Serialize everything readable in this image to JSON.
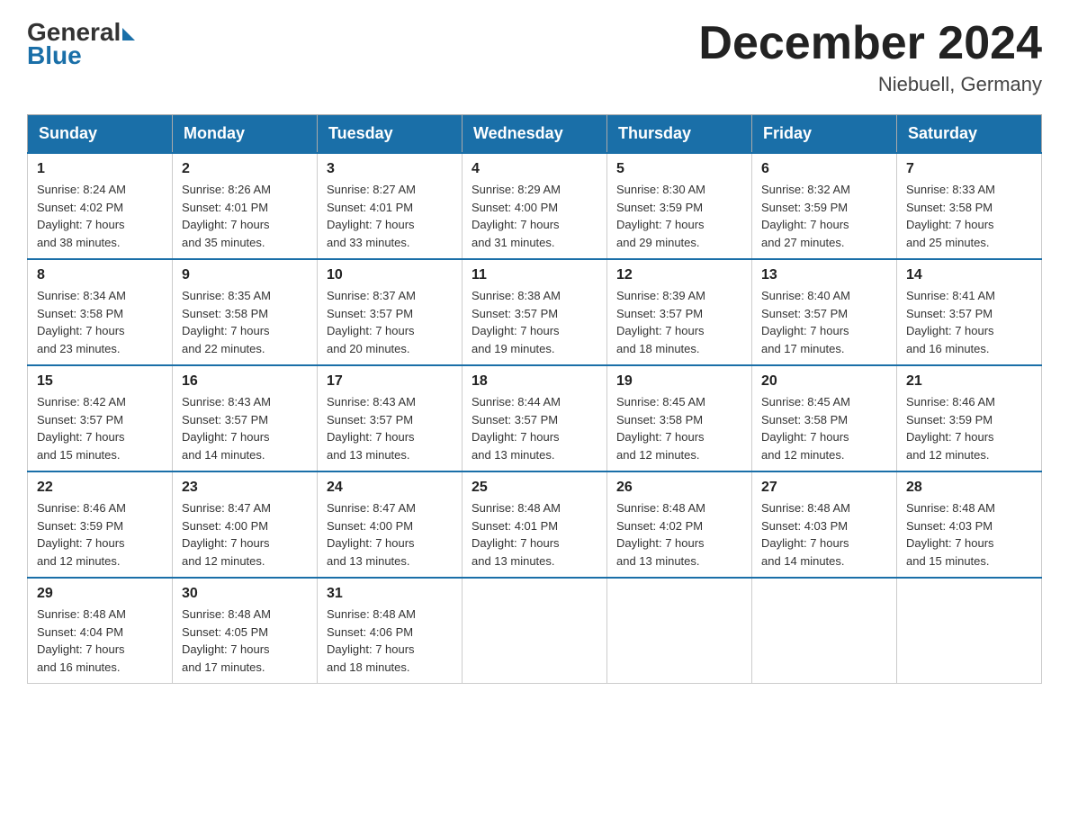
{
  "header": {
    "logo_general": "General",
    "logo_blue": "Blue",
    "month_title": "December 2024",
    "location": "Niebuell, Germany"
  },
  "days_of_week": [
    "Sunday",
    "Monday",
    "Tuesday",
    "Wednesday",
    "Thursday",
    "Friday",
    "Saturday"
  ],
  "weeks": [
    [
      {
        "day": "1",
        "sunrise": "Sunrise: 8:24 AM",
        "sunset": "Sunset: 4:02 PM",
        "daylight": "Daylight: 7 hours",
        "daylight2": "and 38 minutes."
      },
      {
        "day": "2",
        "sunrise": "Sunrise: 8:26 AM",
        "sunset": "Sunset: 4:01 PM",
        "daylight": "Daylight: 7 hours",
        "daylight2": "and 35 minutes."
      },
      {
        "day": "3",
        "sunrise": "Sunrise: 8:27 AM",
        "sunset": "Sunset: 4:01 PM",
        "daylight": "Daylight: 7 hours",
        "daylight2": "and 33 minutes."
      },
      {
        "day": "4",
        "sunrise": "Sunrise: 8:29 AM",
        "sunset": "Sunset: 4:00 PM",
        "daylight": "Daylight: 7 hours",
        "daylight2": "and 31 minutes."
      },
      {
        "day": "5",
        "sunrise": "Sunrise: 8:30 AM",
        "sunset": "Sunset: 3:59 PM",
        "daylight": "Daylight: 7 hours",
        "daylight2": "and 29 minutes."
      },
      {
        "day": "6",
        "sunrise": "Sunrise: 8:32 AM",
        "sunset": "Sunset: 3:59 PM",
        "daylight": "Daylight: 7 hours",
        "daylight2": "and 27 minutes."
      },
      {
        "day": "7",
        "sunrise": "Sunrise: 8:33 AM",
        "sunset": "Sunset: 3:58 PM",
        "daylight": "Daylight: 7 hours",
        "daylight2": "and 25 minutes."
      }
    ],
    [
      {
        "day": "8",
        "sunrise": "Sunrise: 8:34 AM",
        "sunset": "Sunset: 3:58 PM",
        "daylight": "Daylight: 7 hours",
        "daylight2": "and 23 minutes."
      },
      {
        "day": "9",
        "sunrise": "Sunrise: 8:35 AM",
        "sunset": "Sunset: 3:58 PM",
        "daylight": "Daylight: 7 hours",
        "daylight2": "and 22 minutes."
      },
      {
        "day": "10",
        "sunrise": "Sunrise: 8:37 AM",
        "sunset": "Sunset: 3:57 PM",
        "daylight": "Daylight: 7 hours",
        "daylight2": "and 20 minutes."
      },
      {
        "day": "11",
        "sunrise": "Sunrise: 8:38 AM",
        "sunset": "Sunset: 3:57 PM",
        "daylight": "Daylight: 7 hours",
        "daylight2": "and 19 minutes."
      },
      {
        "day": "12",
        "sunrise": "Sunrise: 8:39 AM",
        "sunset": "Sunset: 3:57 PM",
        "daylight": "Daylight: 7 hours",
        "daylight2": "and 18 minutes."
      },
      {
        "day": "13",
        "sunrise": "Sunrise: 8:40 AM",
        "sunset": "Sunset: 3:57 PM",
        "daylight": "Daylight: 7 hours",
        "daylight2": "and 17 minutes."
      },
      {
        "day": "14",
        "sunrise": "Sunrise: 8:41 AM",
        "sunset": "Sunset: 3:57 PM",
        "daylight": "Daylight: 7 hours",
        "daylight2": "and 16 minutes."
      }
    ],
    [
      {
        "day": "15",
        "sunrise": "Sunrise: 8:42 AM",
        "sunset": "Sunset: 3:57 PM",
        "daylight": "Daylight: 7 hours",
        "daylight2": "and 15 minutes."
      },
      {
        "day": "16",
        "sunrise": "Sunrise: 8:43 AM",
        "sunset": "Sunset: 3:57 PM",
        "daylight": "Daylight: 7 hours",
        "daylight2": "and 14 minutes."
      },
      {
        "day": "17",
        "sunrise": "Sunrise: 8:43 AM",
        "sunset": "Sunset: 3:57 PM",
        "daylight": "Daylight: 7 hours",
        "daylight2": "and 13 minutes."
      },
      {
        "day": "18",
        "sunrise": "Sunrise: 8:44 AM",
        "sunset": "Sunset: 3:57 PM",
        "daylight": "Daylight: 7 hours",
        "daylight2": "and 13 minutes."
      },
      {
        "day": "19",
        "sunrise": "Sunrise: 8:45 AM",
        "sunset": "Sunset: 3:58 PM",
        "daylight": "Daylight: 7 hours",
        "daylight2": "and 12 minutes."
      },
      {
        "day": "20",
        "sunrise": "Sunrise: 8:45 AM",
        "sunset": "Sunset: 3:58 PM",
        "daylight": "Daylight: 7 hours",
        "daylight2": "and 12 minutes."
      },
      {
        "day": "21",
        "sunrise": "Sunrise: 8:46 AM",
        "sunset": "Sunset: 3:59 PM",
        "daylight": "Daylight: 7 hours",
        "daylight2": "and 12 minutes."
      }
    ],
    [
      {
        "day": "22",
        "sunrise": "Sunrise: 8:46 AM",
        "sunset": "Sunset: 3:59 PM",
        "daylight": "Daylight: 7 hours",
        "daylight2": "and 12 minutes."
      },
      {
        "day": "23",
        "sunrise": "Sunrise: 8:47 AM",
        "sunset": "Sunset: 4:00 PM",
        "daylight": "Daylight: 7 hours",
        "daylight2": "and 12 minutes."
      },
      {
        "day": "24",
        "sunrise": "Sunrise: 8:47 AM",
        "sunset": "Sunset: 4:00 PM",
        "daylight": "Daylight: 7 hours",
        "daylight2": "and 13 minutes."
      },
      {
        "day": "25",
        "sunrise": "Sunrise: 8:48 AM",
        "sunset": "Sunset: 4:01 PM",
        "daylight": "Daylight: 7 hours",
        "daylight2": "and 13 minutes."
      },
      {
        "day": "26",
        "sunrise": "Sunrise: 8:48 AM",
        "sunset": "Sunset: 4:02 PM",
        "daylight": "Daylight: 7 hours",
        "daylight2": "and 13 minutes."
      },
      {
        "day": "27",
        "sunrise": "Sunrise: 8:48 AM",
        "sunset": "Sunset: 4:03 PM",
        "daylight": "Daylight: 7 hours",
        "daylight2": "and 14 minutes."
      },
      {
        "day": "28",
        "sunrise": "Sunrise: 8:48 AM",
        "sunset": "Sunset: 4:03 PM",
        "daylight": "Daylight: 7 hours",
        "daylight2": "and 15 minutes."
      }
    ],
    [
      {
        "day": "29",
        "sunrise": "Sunrise: 8:48 AM",
        "sunset": "Sunset: 4:04 PM",
        "daylight": "Daylight: 7 hours",
        "daylight2": "and 16 minutes."
      },
      {
        "day": "30",
        "sunrise": "Sunrise: 8:48 AM",
        "sunset": "Sunset: 4:05 PM",
        "daylight": "Daylight: 7 hours",
        "daylight2": "and 17 minutes."
      },
      {
        "day": "31",
        "sunrise": "Sunrise: 8:48 AM",
        "sunset": "Sunset: 4:06 PM",
        "daylight": "Daylight: 7 hours",
        "daylight2": "and 18 minutes."
      },
      null,
      null,
      null,
      null
    ]
  ]
}
